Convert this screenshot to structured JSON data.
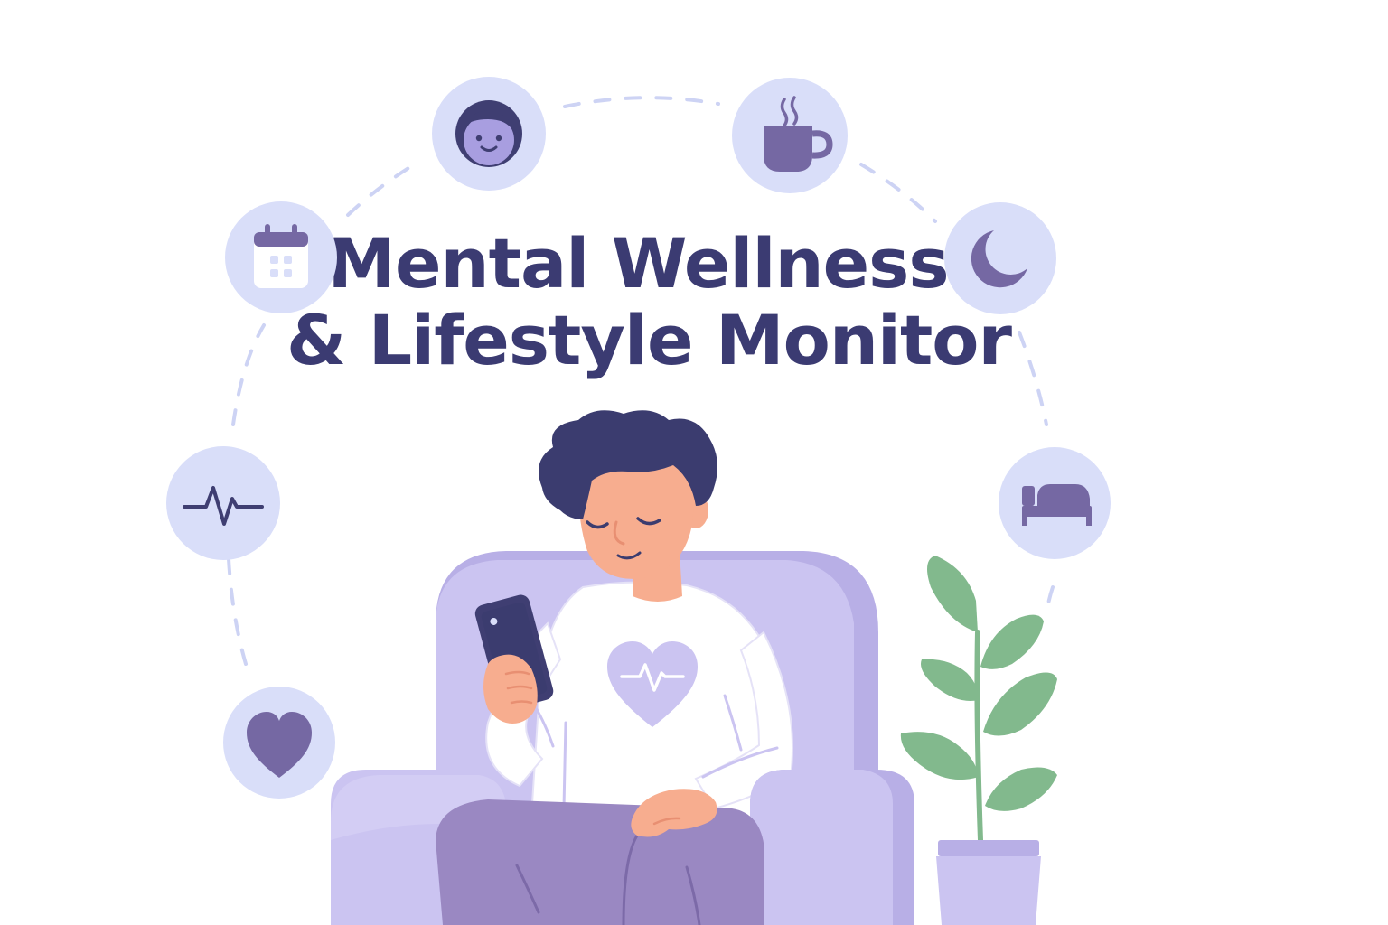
{
  "title": {
    "line1": "Mental Wellness",
    "line2": "& Lifestyle Monitor"
  },
  "colors": {
    "title": "#3b3b72",
    "icon_circle": "#d9def9",
    "icon_fill": "#7568a3",
    "icon_dark": "#3f3e72",
    "dashes": "#cdd3f4",
    "armchair_light": "#cbc4f1",
    "armchair_mid": "#b8afe6",
    "pants": "#9a88c2",
    "skin": "#f7ad8f",
    "hair": "#3b3c6f",
    "shirt": "#ffffff",
    "plant": "#82b98d",
    "pot": "#cbc4f1"
  },
  "icons": [
    {
      "name": "face-icon"
    },
    {
      "name": "coffee-cup-icon"
    },
    {
      "name": "calendar-icon"
    },
    {
      "name": "moon-icon"
    },
    {
      "name": "heartbeat-icon"
    },
    {
      "name": "bed-icon"
    },
    {
      "name": "heart-icon"
    }
  ]
}
